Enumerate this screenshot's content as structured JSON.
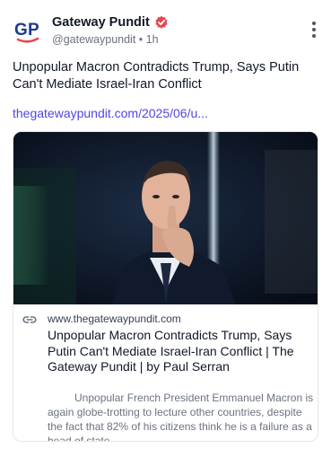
{
  "author": {
    "avatar_initials": "GP",
    "name": "Gateway Pundit",
    "handle": "@gatewaypundit",
    "separator": "•",
    "time": "1h",
    "verified_color": "#e5484d",
    "avatar_blue": "#1e3a8a",
    "avatar_red": "#e5484d"
  },
  "post": {
    "text": "Unpopular Macron Contradicts Trump, Says Putin Can't Mediate Israel-Iran Conflict",
    "link_text": "thegatewaypundit.com/2025/06/u...",
    "link_color": "#4f46e5"
  },
  "card": {
    "domain": "www.thegatewaypundit.com",
    "title": "Unpopular Macron Contradicts Trump, Says Putin Can't Mediate Israel-Iran Conflict | The Gateway Pundit | by Paul Serran",
    "description": "Unpopular French President Emmanuel Macron is again globe-trotting to lecture other countries, despite the fact that 82% of his citizens think he is a failure as a head of state."
  },
  "icons": {
    "verified": "verified-badge-icon",
    "more": "more-options-icon",
    "link": "link-icon"
  }
}
